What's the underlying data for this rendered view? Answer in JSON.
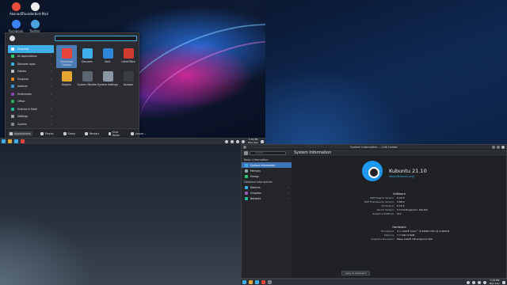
{
  "desktop": {
    "icons": [
      {
        "name": "Akonadi",
        "color": "#e74c3c"
      },
      {
        "name": "Thunderbird Mail",
        "color": "#f0f0f0"
      },
      {
        "name": "Facebook",
        "color": "#3b82f6"
      },
      {
        "name": "Twitter",
        "color": "#4aa3df"
      }
    ]
  },
  "launcher": {
    "categories": [
      {
        "label": "Favorites",
        "color": "#f4f4f4",
        "selected": true
      },
      {
        "label": "All Applications",
        "color": "#2ecc71"
      },
      {
        "label": "Discover apps",
        "color": "#3daee9"
      },
      {
        "label": "Games",
        "color": "#bdc3c7"
      },
      {
        "label": "Graphics",
        "color": "#e67e22"
      },
      {
        "label": "Internet",
        "color": "#3498db"
      },
      {
        "label": "Multimedia",
        "color": "#8e44ad"
      },
      {
        "label": "Office",
        "color": "#27ae60"
      },
      {
        "label": "Science & Math",
        "color": "#1abc9c"
      },
      {
        "label": "Settings",
        "color": "#95a5a6"
      },
      {
        "label": "System",
        "color": "#7f8c8d"
      }
    ],
    "apps": [
      {
        "label": "Chromium Chrome",
        "color": "#e8453c",
        "selected": true
      },
      {
        "label": "Discover",
        "color": "#3daee9"
      },
      {
        "label": "Kate",
        "color": "#2f86d9"
      },
      {
        "label": "LibreOffice",
        "color": "#d13b2f"
      },
      {
        "label": "Dolphin",
        "color": "#e5a631"
      },
      {
        "label": "System Monitor",
        "color": "#5c6670"
      },
      {
        "label": "System Settings",
        "color": "#8b96a3"
      },
      {
        "label": "Konsole",
        "color": "#3a3d42"
      }
    ],
    "footer": {
      "applications": "Applications",
      "places": "Places",
      "sleep": "Sleep",
      "restart": "Restart",
      "shutdown": "Shut Down",
      "leave": "Leave..."
    }
  },
  "panel": {
    "time": "7:34 PM",
    "date": "Mon Dec"
  },
  "infocenter": {
    "window_title": "System Information — Info Center",
    "page_title": "System Information",
    "search_placeholder": "Search...",
    "sidebar": {
      "basic_heading": "Basic Information",
      "basic_items": [
        {
          "label": "System Information",
          "selected": true,
          "color": "#3daee9"
        },
        {
          "label": "Memory",
          "color": "#95a5a6"
        },
        {
          "label": "Energy",
          "color": "#2ecc71"
        }
      ],
      "detailed_heading": "Detailed Information",
      "detailed_items": [
        {
          "label": "Devices",
          "color": "#3daee9"
        },
        {
          "label": "Graphics",
          "color": "#9b59b6"
        },
        {
          "label": "Network",
          "color": "#1abc9c"
        }
      ]
    },
    "distro": {
      "name": "Kubuntu 21.10",
      "link": "https://kubuntu.org/"
    },
    "software_heading": "Software",
    "software": [
      {
        "k": "KDE Plasma Version:",
        "v": "5.22.5"
      },
      {
        "k": "KDE Frameworks Version:",
        "v": "5.86.0"
      },
      {
        "k": "Qt Version:",
        "v": "5.15.2"
      },
      {
        "k": "Kernel Version:",
        "v": "5.13.0-20-generic (64-bit)"
      },
      {
        "k": "Graphics Platform:",
        "v": "X11"
      }
    ],
    "hardware_heading": "Hardware",
    "hardware": [
      {
        "k": "Processors:",
        "v": "4 × Intel® Core™ i5-6300U CPU @ 2.40GHz"
      },
      {
        "k": "Memory:",
        "v": "7.7 GiB of RAM"
      },
      {
        "k": "Graphics Processor:",
        "v": "Mesa Intel® HD Graphics 520"
      }
    ],
    "copy_button": "Copy to Clipboard"
  }
}
